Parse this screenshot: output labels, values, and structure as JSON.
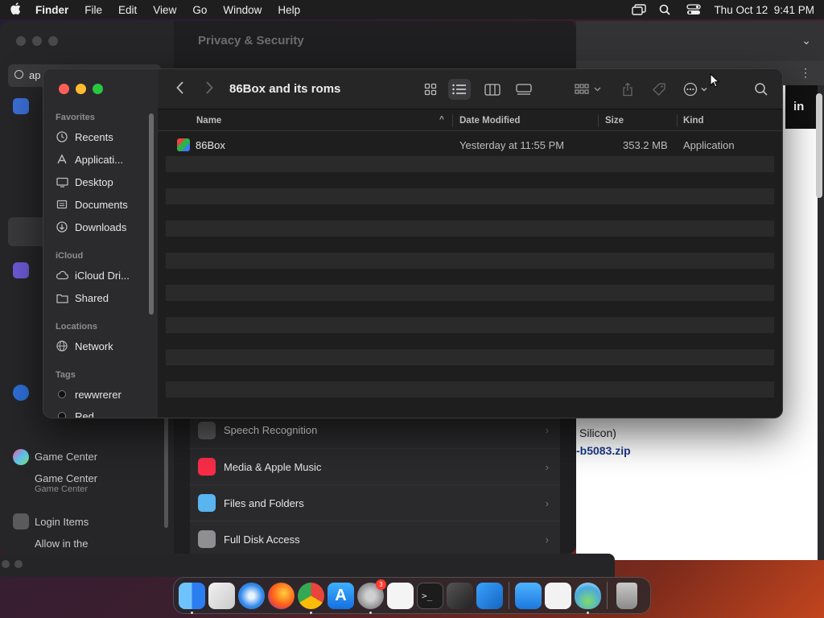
{
  "menubar": {
    "app_name": "Finder",
    "menus": [
      "File",
      "Edit",
      "View",
      "Go",
      "Window",
      "Help"
    ],
    "clock": "Thu Oct 12  9:41 PM",
    "icons": [
      "screen-mirroring-icon",
      "spotlight-icon",
      "control-center-icon"
    ]
  },
  "settings": {
    "title": "Privacy & Security",
    "search_value": "ap",
    "sidebar": [
      {
        "label": "Game Center",
        "sub": "Game Center"
      },
      {
        "label": "Login Items",
        "sub": "Allow in the"
      }
    ],
    "list_rows": [
      {
        "label": "Speech Recognition",
        "color": "#5a5a5c"
      },
      {
        "label": "Media & Apple Music",
        "color": "#fa2d48"
      },
      {
        "label": "Files and Folders",
        "color": "#59b4f0"
      },
      {
        "label": "Full Disk Access",
        "color": "#8e8e93"
      }
    ]
  },
  "browser": {
    "signin_fragment": "in",
    "text_line1": "Silicon)",
    "text_line2": "-b5083.zip"
  },
  "finder": {
    "window_title": "86Box and its roms",
    "sidebar": {
      "favorites_header": "Favorites",
      "favorites": [
        {
          "label": "Recents",
          "icon": "clock-icon"
        },
        {
          "label": "Applicati...",
          "icon": "applications-icon"
        },
        {
          "label": "Desktop",
          "icon": "desktop-icon"
        },
        {
          "label": "Documents",
          "icon": "document-icon"
        },
        {
          "label": "Downloads",
          "icon": "download-icon"
        }
      ],
      "icloud_header": "iCloud",
      "icloud": [
        {
          "label": "iCloud Dri...",
          "icon": "cloud-icon"
        },
        {
          "label": "Shared",
          "icon": "shared-folder-icon"
        }
      ],
      "locations_header": "Locations",
      "locations": [
        {
          "label": "Network",
          "icon": "globe-icon"
        }
      ],
      "tags_header": "Tags",
      "tags": [
        {
          "label": "rewwrerer",
          "color": "#111111"
        },
        {
          "label": "Red",
          "color": "#111111"
        }
      ]
    },
    "columns": {
      "name": "Name",
      "date": "Date Modified",
      "size": "Size",
      "kind": "Kind"
    },
    "files": [
      {
        "name": "86Box",
        "date": "Yesterday at 11:55 PM",
        "size": "353.2 MB",
        "kind": "Application"
      }
    ]
  },
  "dock": {
    "apps": [
      {
        "name": "finder",
        "color": "#3a8ef0",
        "running": true
      },
      {
        "name": "launchpad",
        "color": "#d8d8d8",
        "running": false
      },
      {
        "name": "safari",
        "color": "#2f86e8",
        "running": false
      },
      {
        "name": "firefox",
        "color": "#ff7a1a",
        "running": false
      },
      {
        "name": "chrome",
        "color": "#e8453c",
        "running": true
      },
      {
        "name": "app-store",
        "color": "#1f8fff",
        "running": false
      },
      {
        "name": "system-settings",
        "color": "#8a8a8e",
        "running": true,
        "badge": "3"
      },
      {
        "name": "textedit",
        "color": "#f4f4f4",
        "running": false
      },
      {
        "name": "terminal",
        "color": "#1c1c1c",
        "running": false
      },
      {
        "name": "garageband",
        "color": "#3b3b3b",
        "running": false
      },
      {
        "name": "vscode",
        "color": "#1f7ad4",
        "running": false
      },
      {
        "name": "weather",
        "color": "#3a9cf0",
        "running": false
      },
      {
        "name": "freeform",
        "color": "#f2f2f2",
        "running": false
      },
      {
        "name": "potion",
        "color": "#9bd0f0",
        "running": true
      },
      {
        "name": "trash",
        "color": "#9a9a9a",
        "running": false
      }
    ]
  }
}
